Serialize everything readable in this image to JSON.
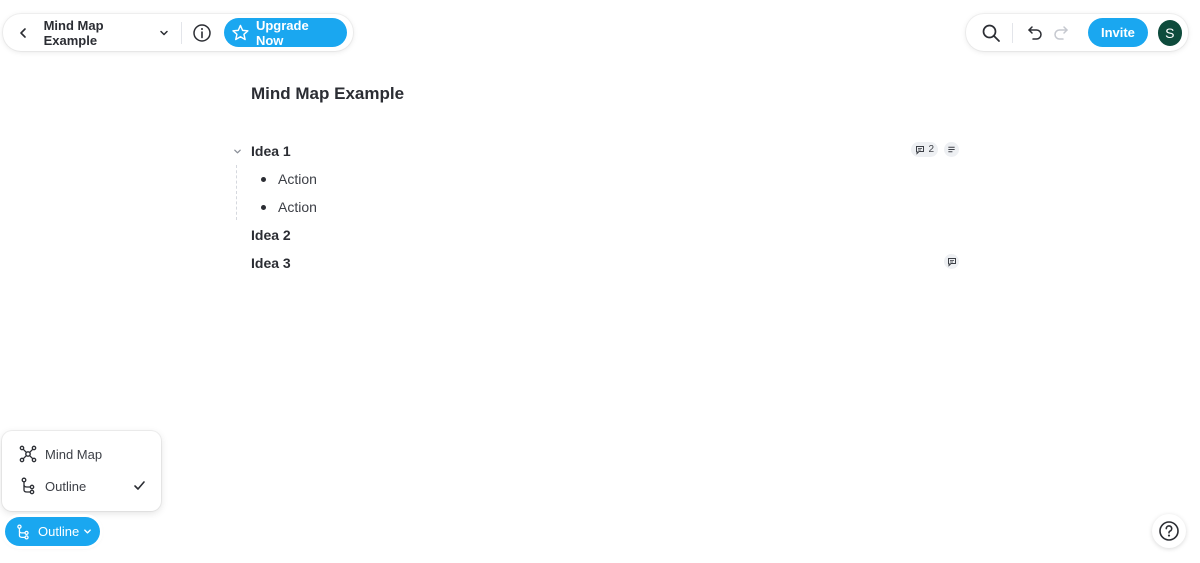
{
  "header": {
    "doc_title": "Mind Map Example",
    "upgrade_label": "Upgrade Now",
    "invite_label": "Invite",
    "avatar_initial": "S"
  },
  "canvas": {
    "title": "Mind Map Example",
    "ideas": [
      {
        "label": "Idea 1",
        "expanded": true,
        "comment_count": "2",
        "has_notes": true,
        "children": [
          "Action",
          "Action"
        ]
      },
      {
        "label": "Idea 2",
        "children": []
      },
      {
        "label": "Idea 3",
        "has_comment": true,
        "children": []
      }
    ]
  },
  "view_menu": {
    "items": [
      {
        "label": "Mind Map",
        "icon": "mind-map-icon",
        "selected": false
      },
      {
        "label": "Outline",
        "icon": "outline-icon",
        "selected": true
      }
    ]
  },
  "view_switch": {
    "label": "Outline"
  },
  "colors": {
    "accent": "#1aa7f0",
    "avatar": "#0e4b3c",
    "text": "#2b2d33"
  }
}
